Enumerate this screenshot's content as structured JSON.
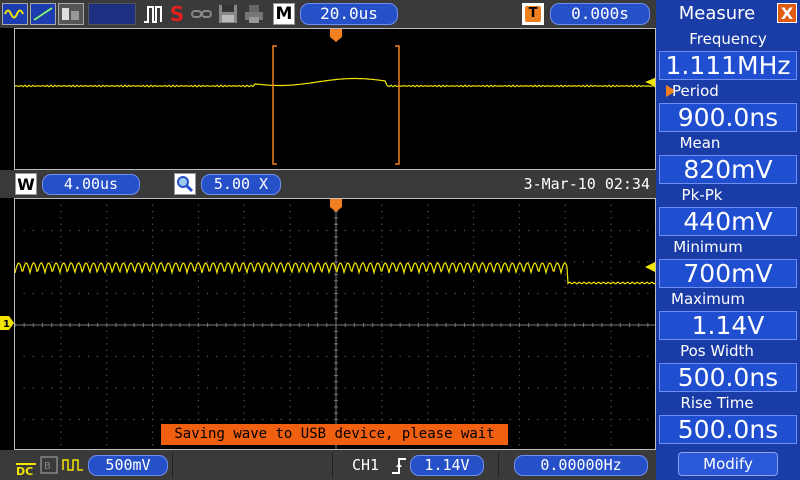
{
  "top_bar": {
    "timebase": "20.0us",
    "trigger_position": "0.000s",
    "mode_letter": "M",
    "trigger_letter": "T",
    "s_label": "S"
  },
  "zoom_bar": {
    "window_letter": "W",
    "window_timebase": "4.00us",
    "zoom_factor": "5.00 X",
    "datetime": "3-Mar-10 02:34"
  },
  "status_message": "Saving wave to USB device, please wait",
  "bottom_bar": {
    "coupling": "DC",
    "volts_div": "500mV",
    "channel": "CH1",
    "trigger_level": "1.14V",
    "frequency": "0.00000Hz"
  },
  "channel_marker": "1",
  "measure_panel": {
    "title": "Measure",
    "close_label": "X",
    "items": [
      {
        "label": "Frequency",
        "value": "1.111MHz"
      },
      {
        "label": "Period",
        "value": "900.0ns",
        "selected": true
      },
      {
        "label": "Mean",
        "value": "820mV"
      },
      {
        "label": "Pk-Pk",
        "value": "440mV"
      },
      {
        "label": "Minimum",
        "value": "700mV"
      },
      {
        "label": "Maximum",
        "value": "1.14V"
      },
      {
        "label": "Pos Width",
        "value": "500.0ns"
      },
      {
        "label": "Rise Time",
        "value": "500.0ns"
      }
    ],
    "modify_label": "Modify"
  },
  "colors": {
    "trace": "#f2e600",
    "accent_blue": "#2650c8",
    "panel_blue": "#1f4fd0",
    "trigger_orange": "#f08020",
    "message_orange": "#f06010"
  },
  "icons": [
    "waveform-type-icon",
    "vector-icon",
    "persist-icon",
    "pulse-icon",
    "link-icon",
    "save-icon",
    "print-icon",
    "magnify-icon",
    "rising-edge-icon",
    "trigger-marker-icon",
    "ch1-marker-icon"
  ]
}
